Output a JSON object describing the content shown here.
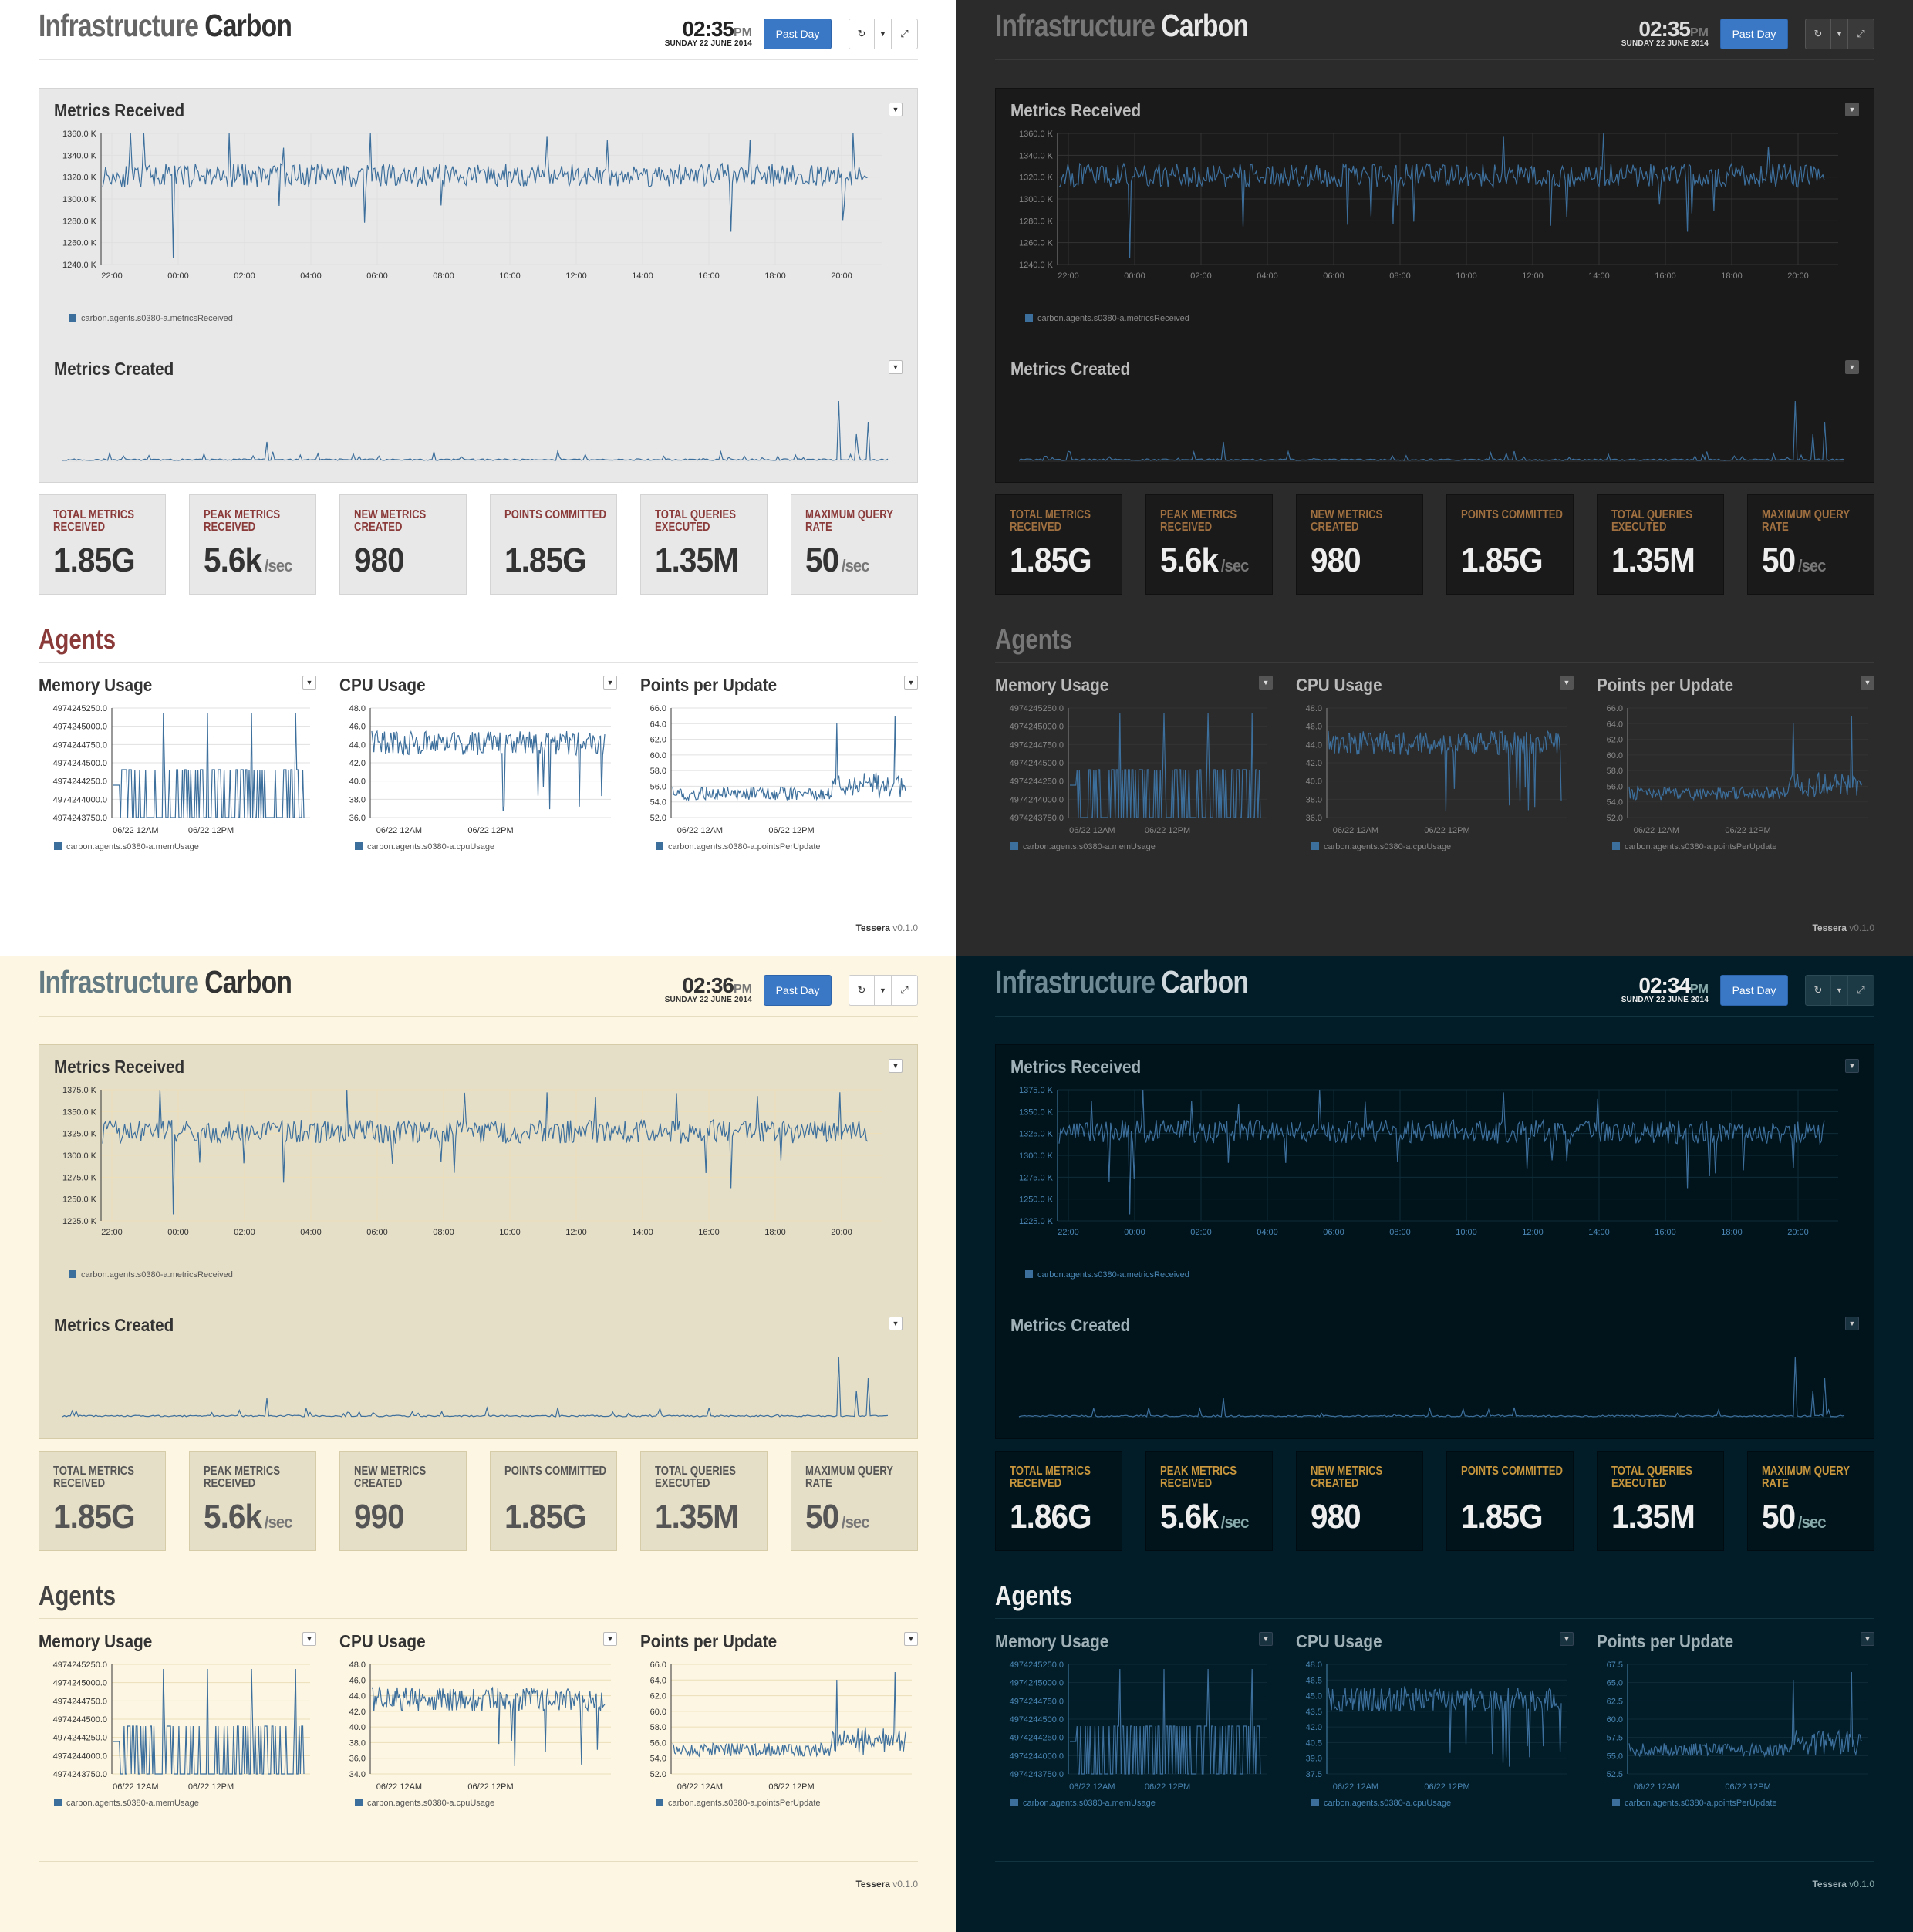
{
  "dashboards": [
    {
      "theme": "light",
      "title_primary": "Infrastructure",
      "title_secondary": "Carbon",
      "clock_time": "02:35",
      "clock_ampm": "PM",
      "clock_date": "SUNDAY 22 JUNE 2014",
      "time_range_button": "Past Day",
      "refresh_icon": "refresh-icon",
      "menu_icon": "caret-down-icon",
      "fullscreen_icon": "compress-icon",
      "metrics_received": {
        "title": "Metrics Received",
        "yticks": [
          "1360.0 K",
          "1340.0 K",
          "1320.0 K",
          "1300.0 K",
          "1280.0 K",
          "1260.0 K",
          "1240.0 K"
        ],
        "ymin": 1240,
        "ymax": 1360,
        "legend": "carbon.agents.s0380-a.metricsReceived"
      },
      "metrics_created": {
        "title": "Metrics Created"
      },
      "stats": [
        {
          "label": "Total Metrics Received",
          "value": "1.85G",
          "unit": ""
        },
        {
          "label": "Peak Metrics Received",
          "value": "5.6k",
          "unit": "/sec"
        },
        {
          "label": "New Metrics Created",
          "value": "980",
          "unit": ""
        },
        {
          "label": "Points Committed",
          "value": "1.85G",
          "unit": ""
        },
        {
          "label": "Total Queries Executed",
          "value": "1.35M",
          "unit": ""
        },
        {
          "label": "Maximum Query Rate",
          "value": "50",
          "unit": "/sec"
        }
      ],
      "section_title": "Agents",
      "agents": [
        {
          "title": "Memory Usage",
          "yticks": [
            "4974245250.0",
            "4974245000.0",
            "4974244750.0",
            "4974244500.0",
            "4974244250.0",
            "4974244000.0",
            "4974243750.0"
          ],
          "legend": "carbon.agents.s0380-a.memUsage"
        },
        {
          "title": "CPU Usage",
          "yticks": [
            "48.0",
            "46.0",
            "44.0",
            "42.0",
            "40.0",
            "38.0",
            "36.0"
          ],
          "legend": "carbon.agents.s0380-a.cpuUsage"
        },
        {
          "title": "Points per Update",
          "yticks": [
            "66.0",
            "64.0",
            "62.0",
            "60.0",
            "58.0",
            "56.0",
            "54.0",
            "52.0"
          ],
          "legend": "carbon.agents.s0380-a.pointsPerUpdate"
        }
      ],
      "footer_brand": "Tessera",
      "footer_version": "v0.1.0"
    },
    {
      "theme": "dark",
      "title_primary": "Infrastructure",
      "title_secondary": "Carbon",
      "clock_time": "02:35",
      "clock_ampm": "PM",
      "clock_date": "SUNDAY 22 JUNE 2014",
      "time_range_button": "Past Day",
      "refresh_icon": "refresh-icon",
      "menu_icon": "caret-down-icon",
      "fullscreen_icon": "compress-icon",
      "metrics_received": {
        "title": "Metrics Received",
        "yticks": [
          "1360.0 K",
          "1340.0 K",
          "1320.0 K",
          "1300.0 K",
          "1280.0 K",
          "1260.0 K",
          "1240.0 K"
        ],
        "ymin": 1240,
        "ymax": 1360,
        "legend": "carbon.agents.s0380-a.metricsReceived"
      },
      "metrics_created": {
        "title": "Metrics Created"
      },
      "stats": [
        {
          "label": "Total Metrics Received",
          "value": "1.85G",
          "unit": ""
        },
        {
          "label": "Peak Metrics Received",
          "value": "5.6k",
          "unit": "/sec"
        },
        {
          "label": "New Metrics Created",
          "value": "980",
          "unit": ""
        },
        {
          "label": "Points Committed",
          "value": "1.85G",
          "unit": ""
        },
        {
          "label": "Total Queries Executed",
          "value": "1.35M",
          "unit": ""
        },
        {
          "label": "Maximum Query Rate",
          "value": "50",
          "unit": "/sec"
        }
      ],
      "section_title": "Agents",
      "agents": [
        {
          "title": "Memory Usage",
          "yticks": [
            "4974245250.0",
            "4974245000.0",
            "4974244750.0",
            "4974244500.0",
            "4974244250.0",
            "4974244000.0",
            "4974243750.0"
          ],
          "legend": "carbon.agents.s0380-a.memUsage"
        },
        {
          "title": "CPU Usage",
          "yticks": [
            "48.0",
            "46.0",
            "44.0",
            "42.0",
            "40.0",
            "38.0",
            "36.0"
          ],
          "legend": "carbon.agents.s0380-a.cpuUsage"
        },
        {
          "title": "Points per Update",
          "yticks": [
            "66.0",
            "64.0",
            "62.0",
            "60.0",
            "58.0",
            "56.0",
            "54.0",
            "52.0"
          ],
          "legend": "carbon.agents.s0380-a.pointsPerUpdate"
        }
      ],
      "footer_brand": "Tessera",
      "footer_version": "v0.1.0"
    },
    {
      "theme": "solarized",
      "title_primary": "Infrastructure",
      "title_secondary": "Carbon",
      "clock_time": "02:36",
      "clock_ampm": "PM",
      "clock_date": "SUNDAY 22 JUNE 2014",
      "time_range_button": "Past Day",
      "refresh_icon": "refresh-icon",
      "menu_icon": "caret-down-icon",
      "fullscreen_icon": "compress-icon",
      "metrics_received": {
        "title": "Metrics Received",
        "yticks": [
          "1375.0 K",
          "1350.0 K",
          "1325.0 K",
          "1300.0 K",
          "1275.0 K",
          "1250.0 K",
          "1225.0 K"
        ],
        "ymin": 1225,
        "ymax": 1375,
        "legend": "carbon.agents.s0380-a.metricsReceived"
      },
      "metrics_created": {
        "title": "Metrics Created"
      },
      "stats": [
        {
          "label": "Total Metrics Received",
          "value": "1.85G",
          "unit": ""
        },
        {
          "label": "Peak Metrics Received",
          "value": "5.6k",
          "unit": "/sec"
        },
        {
          "label": "New Metrics Created",
          "value": "990",
          "unit": ""
        },
        {
          "label": "Points Committed",
          "value": "1.85G",
          "unit": ""
        },
        {
          "label": "Total Queries Executed",
          "value": "1.35M",
          "unit": ""
        },
        {
          "label": "Maximum Query Rate",
          "value": "50",
          "unit": "/sec"
        }
      ],
      "section_title": "Agents",
      "agents": [
        {
          "title": "Memory Usage",
          "yticks": [
            "4974245250.0",
            "4974245000.0",
            "4974244750.0",
            "4974244500.0",
            "4974244250.0",
            "4974244000.0",
            "4974243750.0"
          ],
          "legend": "carbon.agents.s0380-a.memUsage"
        },
        {
          "title": "CPU Usage",
          "yticks": [
            "48.0",
            "46.0",
            "44.0",
            "42.0",
            "40.0",
            "38.0",
            "36.0",
            "34.0"
          ],
          "legend": "carbon.agents.s0380-a.cpuUsage"
        },
        {
          "title": "Points per Update",
          "yticks": [
            "66.0",
            "64.0",
            "62.0",
            "60.0",
            "58.0",
            "56.0",
            "54.0",
            "52.0"
          ],
          "legend": "carbon.agents.s0380-a.pointsPerUpdate"
        }
      ],
      "footer_brand": "Tessera",
      "footer_version": "v0.1.0"
    },
    {
      "theme": "blue",
      "title_primary": "Infrastructure",
      "title_secondary": "Carbon",
      "clock_time": "02:34",
      "clock_ampm": "PM",
      "clock_date": "SUNDAY 22 JUNE 2014",
      "time_range_button": "Past Day",
      "refresh_icon": "refresh-icon",
      "menu_icon": "caret-down-icon",
      "fullscreen_icon": "compress-icon",
      "metrics_received": {
        "title": "Metrics Received",
        "yticks": [
          "1375.0 K",
          "1350.0 K",
          "1325.0 K",
          "1300.0 K",
          "1275.0 K",
          "1250.0 K",
          "1225.0 K"
        ],
        "ymin": 1225,
        "ymax": 1375,
        "legend": "carbon.agents.s0380-a.metricsReceived"
      },
      "metrics_created": {
        "title": "Metrics Created"
      },
      "stats": [
        {
          "label": "Total Metrics Received",
          "value": "1.86G",
          "unit": ""
        },
        {
          "label": "Peak Metrics Received",
          "value": "5.6k",
          "unit": "/sec"
        },
        {
          "label": "New Metrics Created",
          "value": "980",
          "unit": ""
        },
        {
          "label": "Points Committed",
          "value": "1.85G",
          "unit": ""
        },
        {
          "label": "Total Queries Executed",
          "value": "1.35M",
          "unit": ""
        },
        {
          "label": "Maximum Query Rate",
          "value": "50",
          "unit": "/sec"
        }
      ],
      "section_title": "Agents",
      "agents": [
        {
          "title": "Memory Usage",
          "yticks": [
            "4974245250.0",
            "4974245000.0",
            "4974244750.0",
            "4974244500.0",
            "4974244250.0",
            "4974244000.0",
            "4974243750.0"
          ],
          "legend": "carbon.agents.s0380-a.memUsage"
        },
        {
          "title": "CPU Usage",
          "yticks": [
            "48.0",
            "46.5",
            "45.0",
            "43.5",
            "42.0",
            "40.5",
            "39.0",
            "37.5"
          ],
          "legend": "carbon.agents.s0380-a.cpuUsage"
        },
        {
          "title": "Points per Update",
          "yticks": [
            "67.5",
            "65.0",
            "62.5",
            "60.0",
            "57.5",
            "55.0",
            "52.5"
          ],
          "legend": "carbon.agents.s0380-a.pointsPerUpdate"
        }
      ],
      "footer_brand": "Tessera",
      "footer_version": "v0.1.0"
    }
  ],
  "time_axis_labels": [
    "22:00",
    "00:00",
    "02:00",
    "04:00",
    "06:00",
    "08:00",
    "10:00",
    "12:00",
    "14:00",
    "16:00",
    "18:00",
    "20:00"
  ],
  "agent_axis_labels": [
    "06/22 12AM",
    "06/22 12PM"
  ],
  "series_color": "#3d6f9c"
}
